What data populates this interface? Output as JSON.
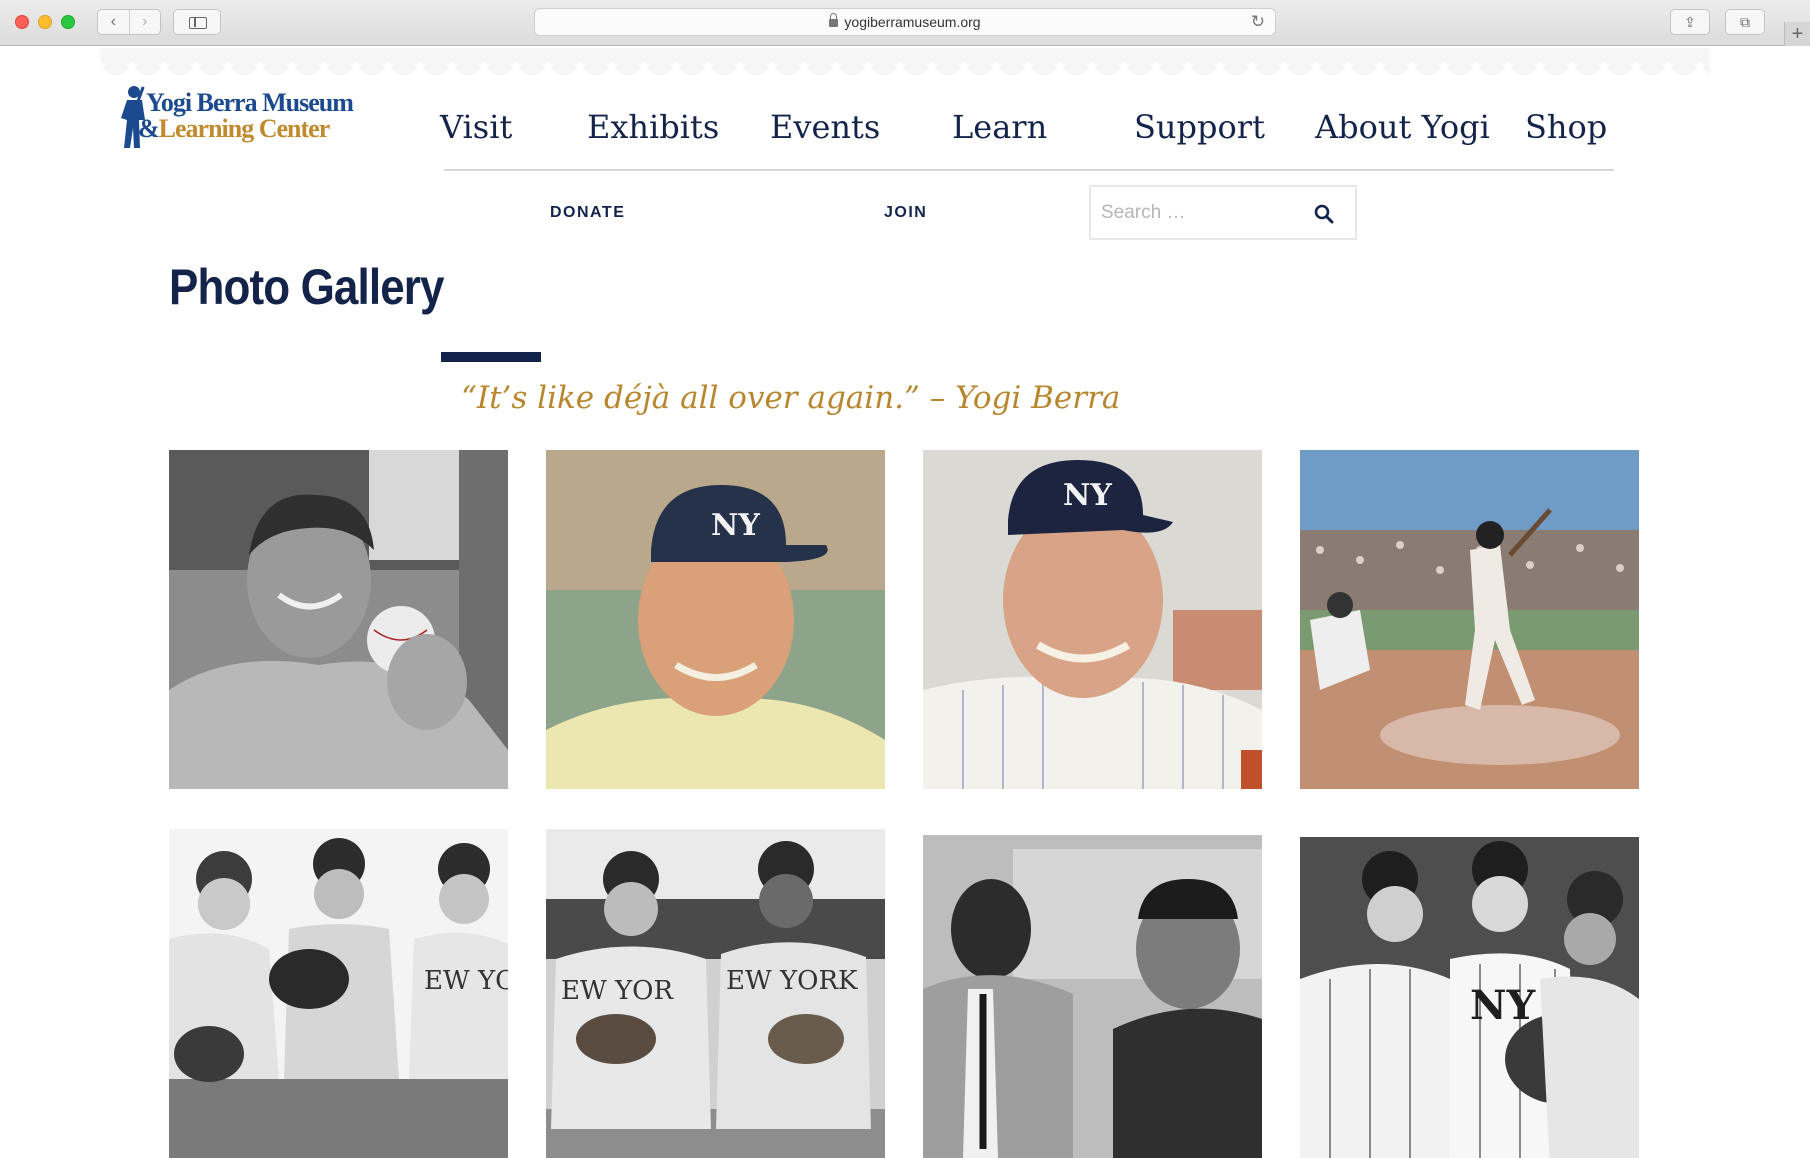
{
  "browser": {
    "url": "yogiberramuseum.org"
  },
  "logo": {
    "line1": "Yogi Berra Museum",
    "line2_amp": "&",
    "line2": "Learning Center"
  },
  "main_nav": [
    {
      "label": "Visit"
    },
    {
      "label": "Exhibits"
    },
    {
      "label": "Events"
    },
    {
      "label": "Learn"
    },
    {
      "label": "Support"
    },
    {
      "label": "About Yogi"
    },
    {
      "label": "Shop"
    }
  ],
  "sub_nav": {
    "donate": "DONATE",
    "join": "JOIN"
  },
  "search": {
    "placeholder": "Search …"
  },
  "page": {
    "title": "Photo Gallery",
    "quote": "“It’s like déjà all over again.” – Yogi Berra"
  },
  "colors": {
    "navy": "#13234a",
    "gold": "#b8862e",
    "logo_blue": "#1b4a8f"
  }
}
